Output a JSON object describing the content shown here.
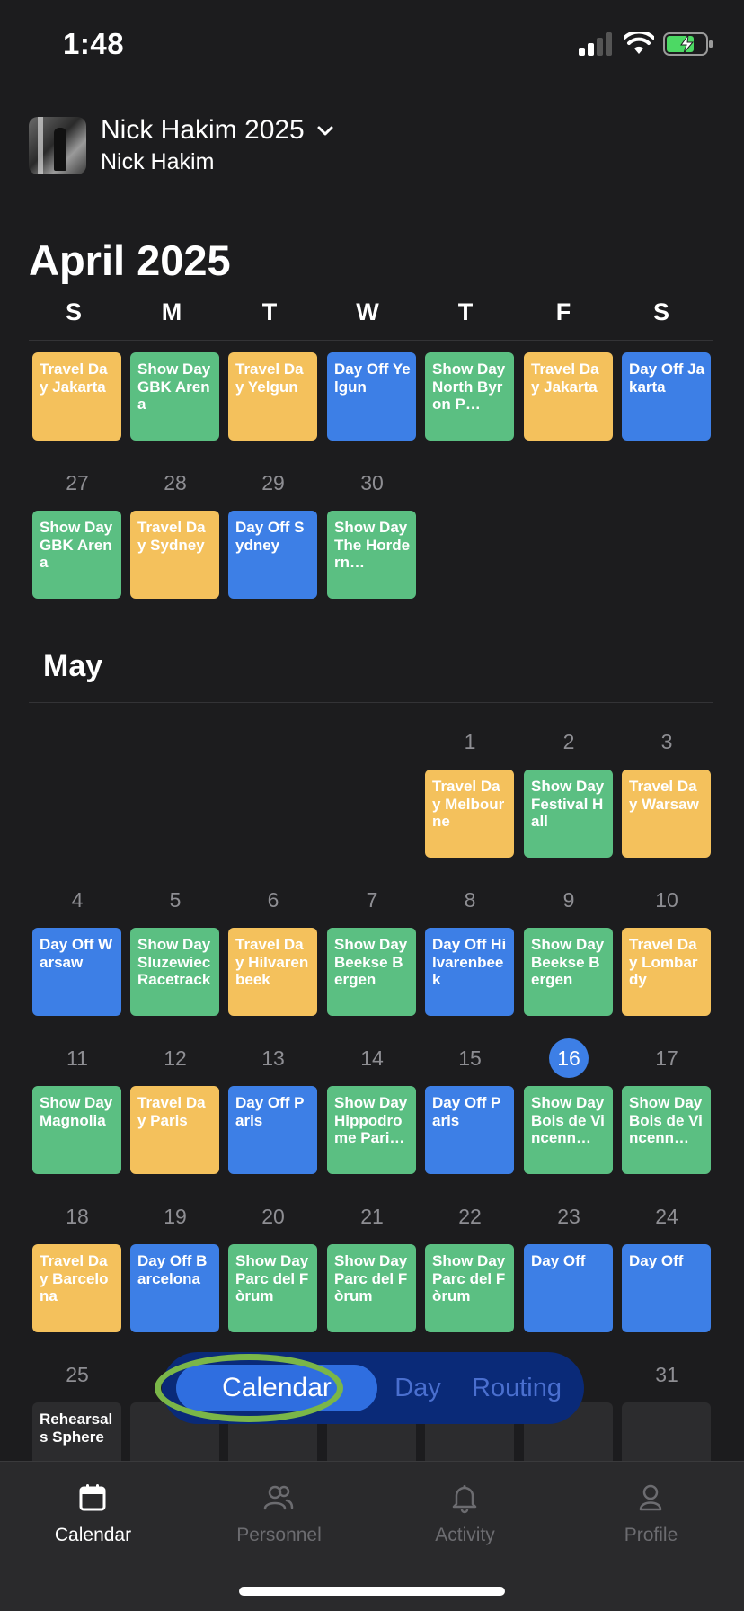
{
  "status_bar": {
    "time": "1:48"
  },
  "header": {
    "tour_title": "Nick Hakim 2025",
    "artist": "Nick Hakim"
  },
  "calendar": {
    "month_title": "April 2025",
    "weekdays": [
      "S",
      "M",
      "T",
      "W",
      "T",
      "F",
      "S"
    ],
    "april_row1": [
      "Travel Day Jakarta",
      "Show Day GBK Arena",
      "Travel Day Yelgun",
      "Day Off Yelgun",
      "Show Day North Byron P…",
      "Travel Day Jakarta",
      "Day Off Jakarta"
    ],
    "april_row2_days": [
      "27",
      "28",
      "29",
      "30"
    ],
    "april_row2": [
      "Show Day GBK Arena",
      "Travel Day Sydney",
      "Day Off Sydney",
      "Show Day The Hordern…"
    ],
    "may_title": "May",
    "may_row1_days": [
      "1",
      "2",
      "3"
    ],
    "may_row1": [
      "Travel Day Melbourne",
      "Show Day Festival Hall",
      "Travel Day Warsaw"
    ],
    "may_row2_days": [
      "4",
      "5",
      "6",
      "7",
      "8",
      "9",
      "10"
    ],
    "may_row2": [
      "Day Off Warsaw",
      "Show Day Sluzewiec Racetrack",
      "Travel Day Hilvarenbeek",
      "Show Day Beekse Bergen",
      "Day Off Hilvarenbeek",
      "Show Day Beekse Bergen",
      "Travel Day Lombardy"
    ],
    "may_row3_days": [
      "11",
      "12",
      "13",
      "14",
      "15",
      "16",
      "17"
    ],
    "may_row3": [
      "Show Day Magnolia",
      "Travel Day Paris",
      "Day Off Paris",
      "Show Day Hippodrome Pari…",
      "Day Off Paris",
      "Show Day Bois de Vincenn…",
      "Show Day Bois de Vincenn…"
    ],
    "may_row4_days": [
      "18",
      "19",
      "20",
      "21",
      "22",
      "23",
      "24"
    ],
    "may_row4": [
      "Travel Day Barcelona",
      "Day Off Barcelona",
      "Show Day Parc del Fòrum",
      "Show Day Parc del Fòrum",
      "Show Day Parc del Fòrum",
      "Day Off",
      "Day Off"
    ],
    "may_row5_days": [
      "25",
      "31"
    ],
    "may_row5": [
      "Rehearsals Sphere"
    ]
  },
  "view_switcher": {
    "options": [
      "Calendar",
      "Day",
      "Routing"
    ],
    "selected": "Calendar"
  },
  "tab_bar": {
    "items": [
      {
        "label": "Calendar",
        "icon": "calendar-icon"
      },
      {
        "label": "Personnel",
        "icon": "people-icon"
      },
      {
        "label": "Activity",
        "icon": "bell-icon"
      },
      {
        "label": "Profile",
        "icon": "person-icon"
      }
    ],
    "active": "Calendar"
  },
  "colors": {
    "travel": "#f4c15c",
    "show": "#5bbf82",
    "off": "#3d7fe6",
    "background": "#1c1c1e",
    "segment": "#0a2a78",
    "highlight": "#7ab648"
  }
}
